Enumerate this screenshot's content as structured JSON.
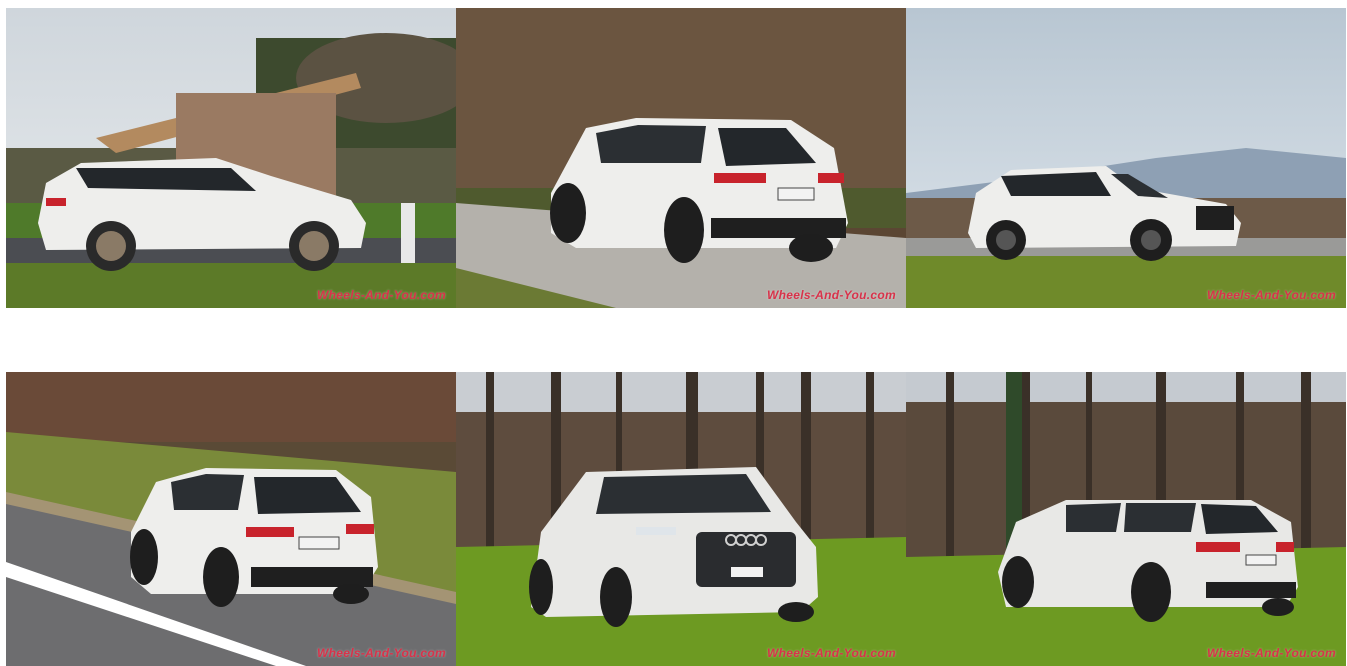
{
  "gallery": {
    "photos": [
      {
        "id": "p1",
        "view": "side-left",
        "watermark": "Wheels-And-You.com"
      },
      {
        "id": "p2",
        "view": "rear-three-quarter-road",
        "watermark": "Wheels-And-You.com"
      },
      {
        "id": "p3",
        "view": "side-right",
        "watermark": "Wheels-And-You.com"
      },
      {
        "id": "p4",
        "view": "rear-high-angle",
        "watermark": "Wheels-And-You.com"
      },
      {
        "id": "p5",
        "view": "front-grass",
        "watermark": "Wheels-And-You.com"
      },
      {
        "id": "p6",
        "view": "rear-grass",
        "watermark": "Wheels-And-You.com"
      }
    ]
  },
  "colors": {
    "car_white": "#eeeeec",
    "glass": "#23272b",
    "tail_light": "#c8232c",
    "grass": "#6f8a2a",
    "road": "#6e6e70",
    "watermark": "#d8324a"
  }
}
